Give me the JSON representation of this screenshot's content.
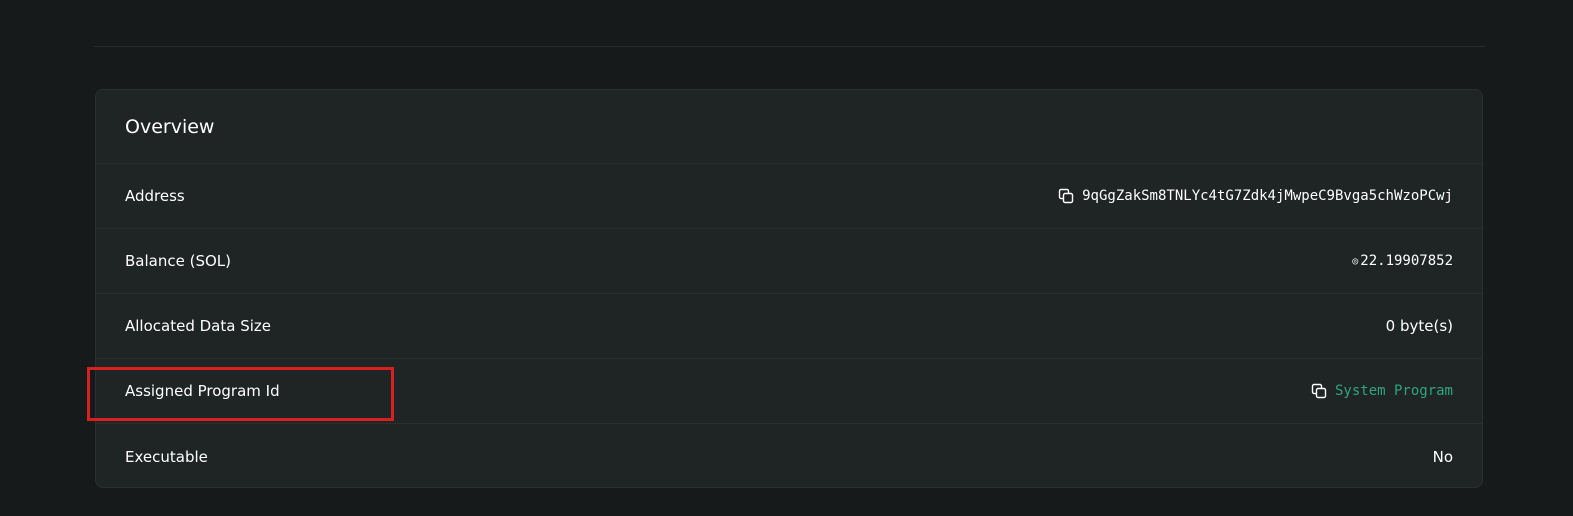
{
  "overview": {
    "title": "Overview",
    "rows": [
      {
        "label": "Address",
        "value": "9qGgZakSm8TNLYc4tG7Zdk4jMwpeC9Bvga5chWzoPCwj",
        "icon": "copy-icon"
      },
      {
        "label": "Balance (SOL)",
        "prefix": "◎",
        "value": "22.19907852"
      },
      {
        "label": "Allocated Data Size",
        "value": "0 byte(s)"
      },
      {
        "label": "Assigned Program Id",
        "value": "System Program",
        "icon": "copy-icon",
        "link_color": "#2fa57f"
      },
      {
        "label": "Executable",
        "value": "No"
      }
    ]
  },
  "annotation": {
    "color": "#d9201e",
    "target": "Assigned Program Id"
  }
}
